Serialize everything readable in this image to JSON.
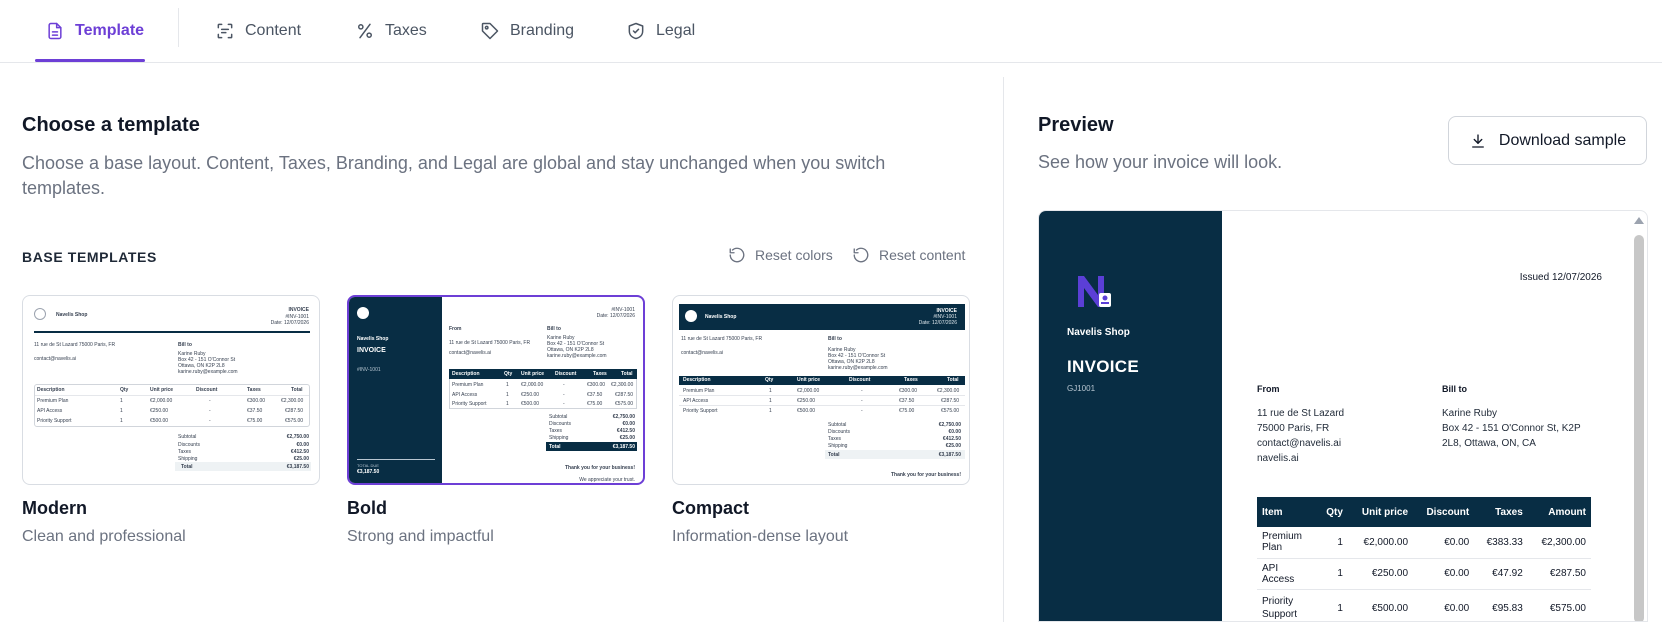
{
  "tabs": [
    {
      "label": "Template",
      "icon": "document-icon",
      "active": true
    },
    {
      "label": "Content",
      "icon": "scan-text-icon",
      "active": false
    },
    {
      "label": "Taxes",
      "icon": "percent-icon",
      "active": false
    },
    {
      "label": "Branding",
      "icon": "tag-icon",
      "active": false
    },
    {
      "label": "Legal",
      "icon": "shield-check-icon",
      "active": false
    }
  ],
  "left": {
    "title": "Choose a template",
    "description": "Choose a base layout. Content, Taxes, Branding, and Legal are global and stay unchanged when you switch templates.",
    "section_label": "BASE TEMPLATES",
    "reset_colors": "Reset colors",
    "reset_content": "Reset content",
    "templates": [
      {
        "name": "Modern",
        "description": "Clean and professional",
        "selected": false
      },
      {
        "name": "Bold",
        "description": "Strong and impactful",
        "selected": true
      },
      {
        "name": "Compact",
        "description": "Information-dense layout",
        "selected": false
      }
    ]
  },
  "thumb": {
    "shop": "Navelis Shop",
    "invoice_small": "INVOICE",
    "invoice_big": "INVOICE",
    "num": "#INV-1001",
    "date": "Date: 12/07/2026",
    "from_label": "From",
    "from_addr1": "11 rue de St Lazard 75000 Paris, FR",
    "from_email": "contact@navelis.ai",
    "bill_label": "Bill to",
    "bill_name": "Karine Ruby",
    "bill_addr1": "Box 42 - 151 O'Connor St",
    "bill_addr2": "Ottawa, ON K2P 2L8",
    "bill_email": "karine.ruby@example.com",
    "headers": [
      "Description",
      "Qty",
      "Unit price",
      "Discount",
      "Taxes",
      "Total"
    ],
    "rows": [
      [
        "Premium Plan",
        "1",
        "€2,000.00",
        "-",
        "€300.00",
        "€2,300.00"
      ],
      [
        "API Access",
        "1",
        "€250.00",
        "-",
        "€37.50",
        "€287.50"
      ],
      [
        "Priority Support",
        "1",
        "€500.00",
        "-",
        "€75.00",
        "€575.00"
      ]
    ],
    "subtotal_label": "Subtotal",
    "subtotal": "€2,750.00",
    "discounts_label": "Discounts",
    "discounts": "€0.00",
    "taxes_label": "Taxes",
    "taxes": "€412.50",
    "shipping_label": "Shipping",
    "shipping": "€25.00",
    "total_label": "Total",
    "total": "€3,187.50",
    "total_due_label": "TOTAL DUE",
    "thanks": "Thank you for your business!",
    "appreciate": "We appreciate your trust."
  },
  "right": {
    "title": "Preview",
    "description": "See how your invoice will look.",
    "download_label": "Download sample"
  },
  "preview": {
    "shop_name": "Navelis Shop",
    "invoice_title": "INVOICE",
    "invoice_number": "GJ1001",
    "issued": "Issued 12/07/2026",
    "from_label": "From",
    "from_lines": [
      "11 rue de St Lazard",
      "75000 Paris, FR",
      "contact@navelis.ai",
      "navelis.ai"
    ],
    "bill_label": "Bill to",
    "bill_lines": [
      "Karine Ruby",
      "Box 42 - 151 O'Connor St, K2P",
      "2L8, Ottawa, ON, CA"
    ],
    "table_headers": [
      "Item",
      "Qty",
      "Unit price",
      "Discount",
      "Taxes",
      "Amount"
    ],
    "table_rows": [
      [
        "Premium Plan",
        "1",
        "€2,000.00",
        "€0.00",
        "€383.33",
        "€2,300.00"
      ],
      [
        "API Access",
        "1",
        "€250.00",
        "€0.00",
        "€47.92",
        "€287.50"
      ],
      [
        "Priority Support",
        "1",
        "€500.00",
        "€0.00",
        "€95.83",
        "€575.00"
      ]
    ]
  },
  "colors": {
    "accent": "#6d3fd6",
    "navy": "#082d44"
  }
}
